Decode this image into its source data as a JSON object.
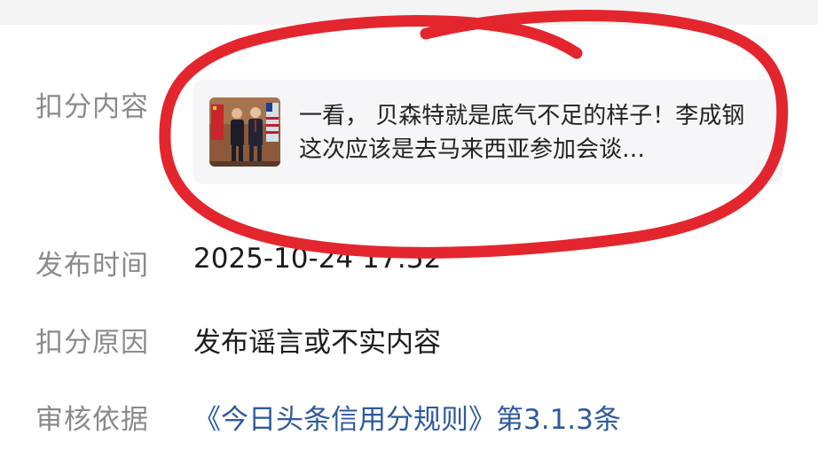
{
  "rows": {
    "content": {
      "label": "扣分内容"
    },
    "time": {
      "label": "发布时间",
      "value": "2025-10-24 17:52"
    },
    "reason": {
      "label": "扣分原因",
      "value": "发布谣言或不实内容"
    },
    "basis": {
      "label": "审核依据",
      "value": "《今日头条信用分规则》第3.1.3条"
    }
  },
  "post_card": {
    "text": "一看， 贝森特就是底气不足的样子！李成钢这次应该是去马来西亚参加会谈…",
    "thumbnail_icon": "photo-two-men-with-flags"
  },
  "colors": {
    "label": "#8a8a8a",
    "value": "#1c1c1c",
    "link": "#2e5a9c",
    "annotation": "#e3262d"
  }
}
